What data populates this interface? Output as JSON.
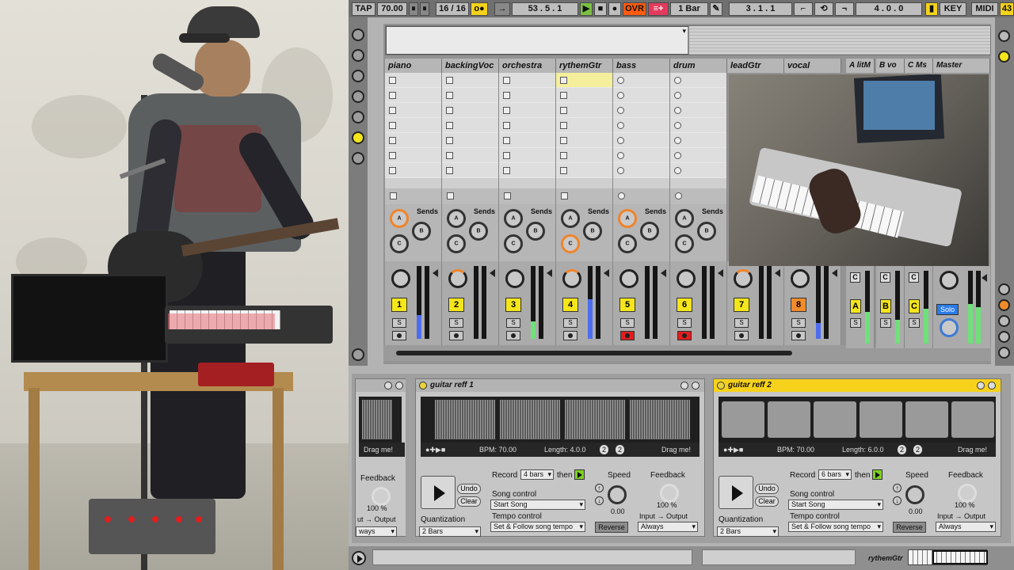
{
  "transport": {
    "tap": "TAP",
    "tempo": "70.00",
    "meter": "16 / 16",
    "metronome_icon": "o●",
    "position": "53 . 5 . 1",
    "ovr": "OVR",
    "quantize": "1 Bar",
    "loop_start": "3 . 1 . 1",
    "loop_length": "4 . 0 . 0",
    "key": "KEY",
    "midi": "MIDI",
    "cpu": "43"
  },
  "tracks": [
    {
      "name": "piano",
      "num": "1",
      "slot": "square"
    },
    {
      "name": "backingVoc",
      "num": "2",
      "slot": "square"
    },
    {
      "name": "orchestra",
      "num": "3",
      "slot": "square"
    },
    {
      "name": "rythemGtr",
      "num": "4",
      "slot": "square"
    },
    {
      "name": "bass",
      "num": "5",
      "slot": "circle"
    },
    {
      "name": "drum",
      "num": "6",
      "slot": "circle"
    },
    {
      "name": "leadGtr",
      "num": "7",
      "slot": "circle"
    },
    {
      "name": "vocal",
      "num": "8",
      "slot": "circle"
    }
  ],
  "returns": [
    {
      "name": "A litM",
      "letter": "A"
    },
    {
      "name": "B vo",
      "letter": "B"
    },
    {
      "name": "C Ms",
      "letter": "C"
    }
  ],
  "master": {
    "name": "Master",
    "solo": "Solo"
  },
  "sends_label": "Sends",
  "solo_label": "S",
  "knob_labels": {
    "a": "A",
    "b": "B",
    "c": "C"
  },
  "looper1": {
    "title": "guitar reff 1",
    "bpm": "BPM: 70.00",
    "length": "Length: 4.0.0",
    "x2a": "2",
    "x2b": "2",
    "drag": "Drag me!",
    "record": "Record",
    "record_val": "4 bars",
    "then": "then",
    "undo": "Undo",
    "clear": "Clear",
    "song_control": "Song control",
    "song_val": "Start Song",
    "tempo_control": "Tempo control",
    "tempo_val": "Set & Follow song tempo",
    "quantization": "Quantization",
    "quant_val": "2 Bars",
    "speed": "Speed",
    "speed_val": "0.00",
    "reverse": "Reverse",
    "feedback": "Feedback",
    "feedback_val": "100 %",
    "io": "Input → Output",
    "io_val": "Always"
  },
  "looper2": {
    "title": "guitar reff 2",
    "bpm": "BPM: 70.00",
    "length": "Length: 6.0.0",
    "x2a": "2",
    "x2b": "2",
    "drag": "Drag me!",
    "record": "Record",
    "record_val": "6 bars",
    "then": "then",
    "undo": "Undo",
    "clear": "Clear",
    "song_control": "Song control",
    "song_val": "Start Song",
    "tempo_control": "Tempo control",
    "tempo_val": "Set & Follow song tempo",
    "quantization": "Quantization",
    "quant_val": "2 Bars",
    "speed": "Speed",
    "speed_val": "0.00",
    "reverse": "Reverse",
    "feedback": "Feedback",
    "feedback_val": "100 %",
    "io": "Input → Output",
    "io_val": "Always"
  },
  "looper0": {
    "drag": "Drag me!",
    "feedback": "Feedback",
    "feedback_val": "100 %",
    "io": "ut → Output",
    "io_val": "ways"
  },
  "statusbar": {
    "track": "rythemGtr"
  },
  "colors": {
    "clip_yellow": "#f5e51b",
    "vocal_orange": "#f08c2b",
    "arm_red": "#e21d1d",
    "meter_green": "#6fe07a",
    "meter_blue": "#4d6df0"
  },
  "icons": [
    "play-icon",
    "stop-icon",
    "record-icon",
    "metronome-icon",
    "draw-mode-icon",
    "loop-icon",
    "punch-in-icon",
    "punch-out-icon"
  ]
}
